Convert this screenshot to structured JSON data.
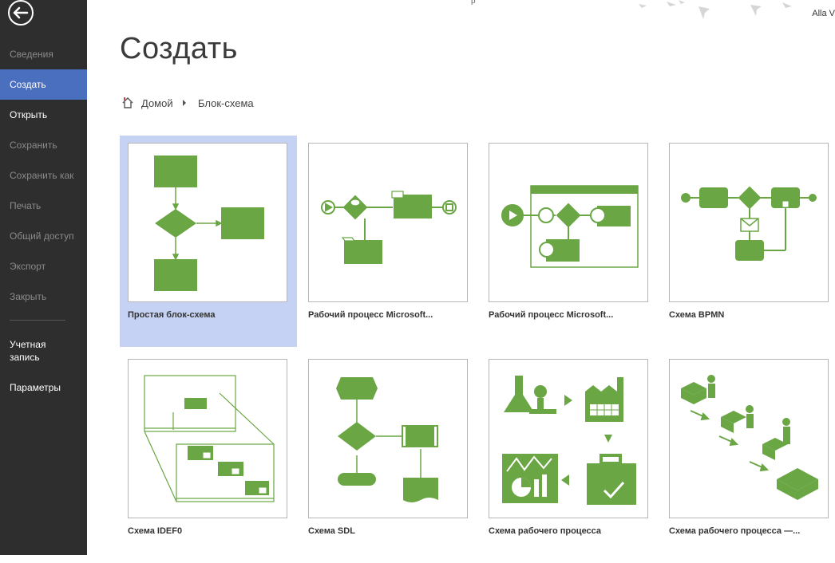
{
  "colors": {
    "sidebar_bg": "#2e2e2e",
    "active_bg": "#4a6fbf",
    "shape_green": "#6aa644",
    "selected_tile": "#c5d2f3"
  },
  "header": {
    "user_name": "Alla V",
    "top_fragment": "р"
  },
  "sidebar": {
    "back_icon": "back-arrow-icon",
    "items": [
      {
        "label": "Сведения",
        "state": "disabled"
      },
      {
        "label": "Создать",
        "state": "active"
      },
      {
        "label": "Открыть",
        "state": "enabled"
      },
      {
        "label": "Сохранить",
        "state": "disabled"
      },
      {
        "label": "Сохранить как",
        "state": "disabled"
      },
      {
        "label": "Печать",
        "state": "disabled"
      },
      {
        "label": "Общий доступ",
        "state": "disabled"
      },
      {
        "label": "Экспорт",
        "state": "disabled"
      },
      {
        "label": "Закрыть",
        "state": "disabled"
      }
    ],
    "bottom_items": [
      {
        "label": "Учетная запись"
      },
      {
        "label": "Параметры"
      }
    ]
  },
  "main": {
    "title": "Создать",
    "breadcrumb": {
      "home_icon": "home-icon",
      "home": "Домой",
      "current": "Блок-схема"
    },
    "templates": [
      {
        "label": "Простая блок-схема",
        "selected": true
      },
      {
        "label": "Рабочий процесс Microsoft..."
      },
      {
        "label": "Рабочий процесс Microsoft..."
      },
      {
        "label": "Схема BPMN"
      },
      {
        "label": "Схема IDEF0"
      },
      {
        "label": "Схема SDL"
      },
      {
        "label": "Схема рабочего процесса"
      },
      {
        "label": "Схема рабочего процесса —..."
      }
    ]
  }
}
